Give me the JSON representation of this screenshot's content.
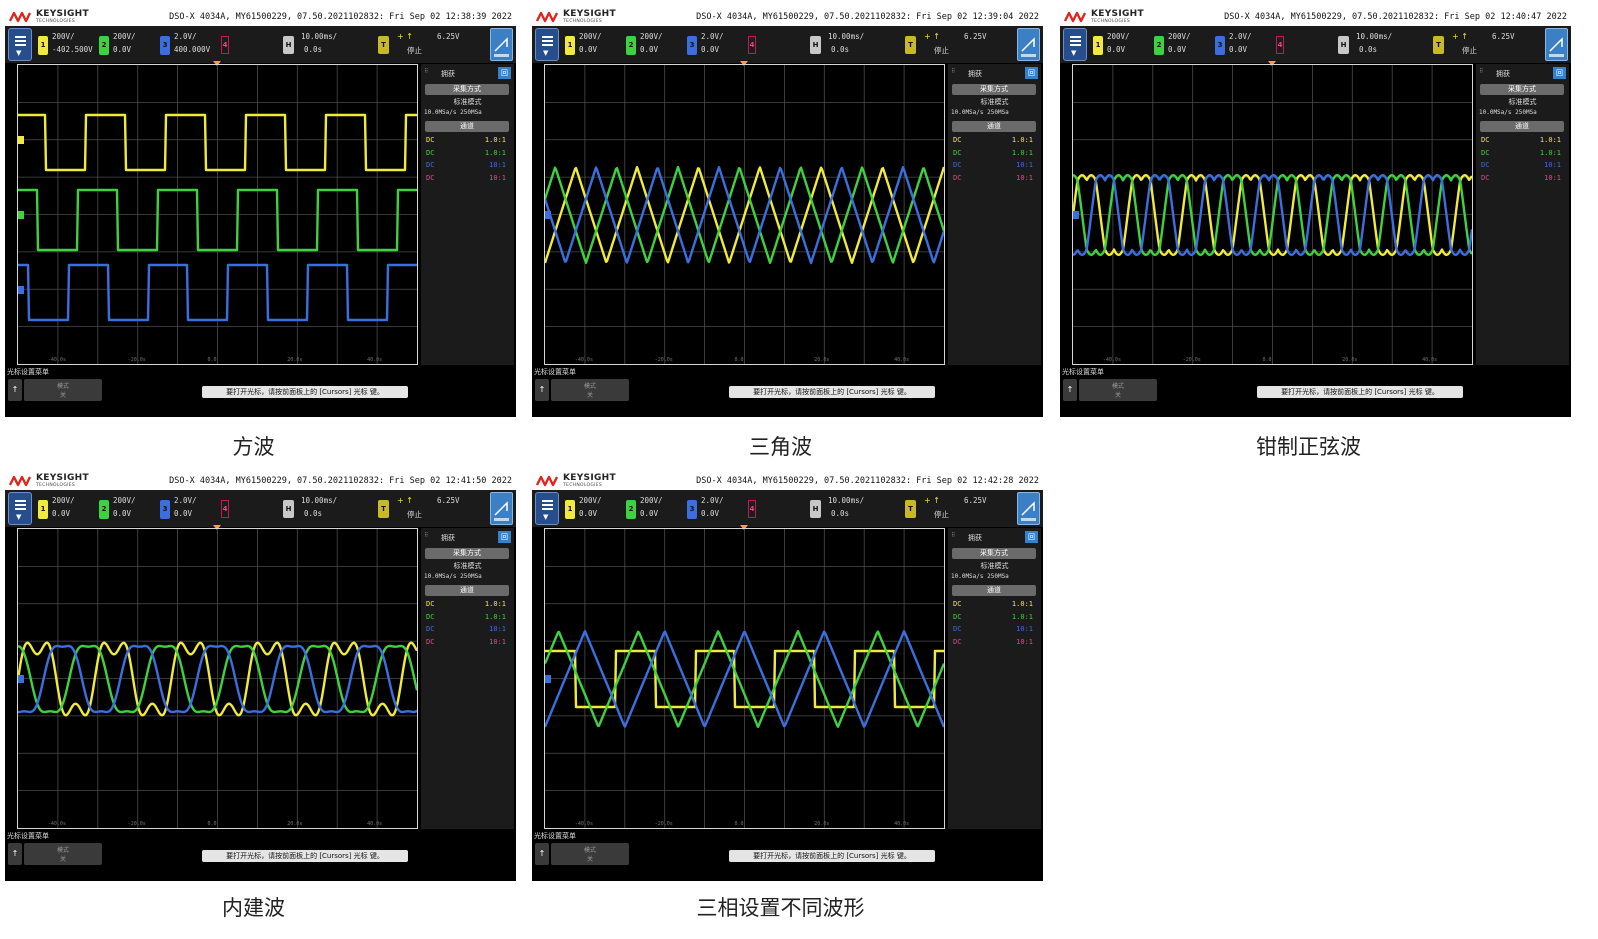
{
  "logo": {
    "brand": "KEYSIGHT",
    "sub": "TECHNOLOGIES"
  },
  "panels": [
    {
      "id": "square",
      "caption": "方波",
      "header": "DSO-X 4034A, MY61500229, 07.50.2021102832: Fri Sep 02 12:38:39 2022",
      "ch1": {
        "scale": "200V/",
        "offset": "-402.500V"
      },
      "ch2": {
        "scale": "200V/",
        "offset": "0.0V"
      },
      "ch3": {
        "scale": "2.0V/",
        "offset": "400.000V"
      },
      "waveform": "square"
    },
    {
      "id": "triangle",
      "caption": "三角波",
      "header": "DSO-X 4034A, MY61500229, 07.50.2021102832: Fri Sep 02 12:39:04 2022",
      "ch1": {
        "scale": "200V/",
        "offset": "0.0V"
      },
      "ch2": {
        "scale": "200V/",
        "offset": "0.0V"
      },
      "ch3": {
        "scale": "2.0V/",
        "offset": "0.0V"
      },
      "waveform": "triangle"
    },
    {
      "id": "clamped",
      "caption": "钳制正弦波",
      "header": "DSO-X 4034A, MY61500229, 07.50.2021102832: Fri Sep 02 12:40:47 2022",
      "ch1": {
        "scale": "200V/",
        "offset": "0.0V"
      },
      "ch2": {
        "scale": "200V/",
        "offset": "0.0V"
      },
      "ch3": {
        "scale": "2.0V/",
        "offset": "0.0V"
      },
      "waveform": "clamped"
    },
    {
      "id": "builtin",
      "caption": "内建波",
      "header": "DSO-X 4034A, MY61500229, 07.50.2021102832: Fri Sep 02 12:41:50 2022",
      "ch1": {
        "scale": "200V/",
        "offset": "0.0V"
      },
      "ch2": {
        "scale": "200V/",
        "offset": "0.0V"
      },
      "ch3": {
        "scale": "2.0V/",
        "offset": "0.0V"
      },
      "waveform": "builtin"
    },
    {
      "id": "mixed",
      "caption": "三相设置不同波形",
      "header": "DSO-X 4034A, MY61500229, 07.50.2021102832: Fri Sep 02 12:42:28 2022",
      "ch1": {
        "scale": "200V/",
        "offset": "0.0V"
      },
      "ch2": {
        "scale": "200V/",
        "offset": "0.0V"
      },
      "ch3": {
        "scale": "2.0V/",
        "offset": "0.0V"
      },
      "waveform": "mixed"
    }
  ],
  "scope_ui": {
    "ch4_tag": "4",
    "h_tag": "H",
    "timebase": "10.00ms/",
    "delay": "0.0s",
    "t_tag": "T",
    "trigger_symbol": "+ ↑",
    "trigger_level": "6.25V",
    "run_state": "停止",
    "side_title": "拥获",
    "side_icon": "回",
    "acq_btn": "采集方式",
    "acq_mode": "标准模式",
    "sample_rate": "10.0MSa/s  250MSa",
    "channels_btn": "通道",
    "channels": [
      {
        "coupling": "DC",
        "probe": "1.0:1"
      },
      {
        "coupling": "DC",
        "probe": "1.0:1"
      },
      {
        "coupling": "DC",
        "probe": "10:1"
      },
      {
        "coupling": "DC",
        "probe": "10:1"
      }
    ],
    "footer_label": "光标设置菜单",
    "mode_line1": "模式",
    "mode_line2": "关",
    "hint": "要打开光标，请按前面板上的 [Cursors] 光标 键。",
    "back_glyph": "↑",
    "x_ticks": [
      "-40.0s",
      "-20.0s",
      "0.0",
      "20.0s",
      "40.0s"
    ]
  },
  "colors": {
    "ch1": "#f0ea3c",
    "ch2": "#3fd13f",
    "ch3": "#3b6fe0",
    "ch4": "#e04b8a",
    "grid": "#4b4b4b",
    "grid_border": "#d6d6d6"
  }
}
